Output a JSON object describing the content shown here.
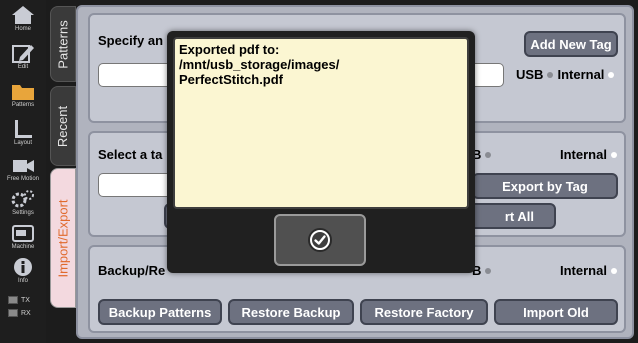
{
  "nav": {
    "items": [
      {
        "label": "Home",
        "icon": "home-icon"
      },
      {
        "label": "Edit",
        "icon": "pencil-icon"
      },
      {
        "label": "Patterns",
        "icon": "folder-icon"
      },
      {
        "label": "Layout",
        "icon": "ruler-icon"
      },
      {
        "label": "Free Motion",
        "icon": "camera-icon"
      },
      {
        "label": "Settings",
        "icon": "gears-icon"
      },
      {
        "label": "Machine",
        "icon": "sewing-machine-icon"
      },
      {
        "label": "Info",
        "icon": "info-icon"
      }
    ],
    "tx": "TX",
    "rx": "RX"
  },
  "tabs": {
    "patterns": "Patterns",
    "recent": "Recent",
    "import_export": "Import/Export"
  },
  "section1": {
    "title": "Specify an",
    "add_tag": "Add New Tag",
    "usb": "USB",
    "internal": "Internal"
  },
  "section2": {
    "title": "Select a ta",
    "usb": "B",
    "internal": "Internal",
    "export_by_tag": "Export by Tag",
    "export_all": "rt All"
  },
  "section3": {
    "title": "Backup/Re",
    "usb": "B",
    "internal": "Internal",
    "backup_patterns": "Backup Patterns",
    "restore_backup": "Restore Backup",
    "restore_factory": "Restore Factory",
    "import_old": "Import Old"
  },
  "dialog": {
    "line1": "Exported pdf to:",
    "line2": "/mnt/usb_storage/images/",
    "line3": "PerfectStitch.pdf",
    "ok_icon": "check-circle-icon"
  },
  "colors": {
    "accent_tab": "#e06a2c",
    "nav_active": "#e8a53b",
    "dialog_bg": "#fbf6d2",
    "button": "#6d7180"
  }
}
